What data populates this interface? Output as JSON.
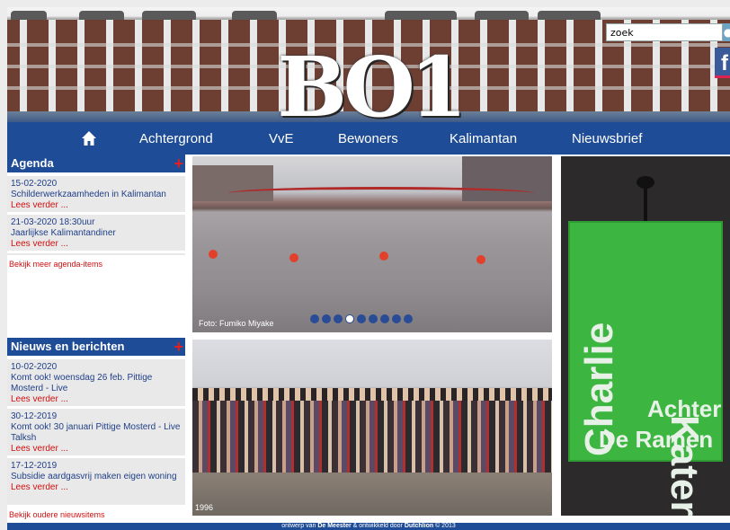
{
  "header": {
    "logo_text": "BO1",
    "search": {
      "value": "zoek",
      "placeholder": "zoek"
    },
    "facebook_icon": "f"
  },
  "nav": {
    "home_icon": "home-icon",
    "items": [
      {
        "label": "Achtergrond"
      },
      {
        "label": "VvE"
      },
      {
        "label": "Bewoners"
      },
      {
        "label": "Kalimantan"
      },
      {
        "label": "Nieuwsbrief"
      }
    ]
  },
  "agenda": {
    "title": "Agenda",
    "items": [
      {
        "date": "15-02-2020",
        "title": "Schilderwerkzaamheden in Kalimantan",
        "more": "Lees verder ..."
      },
      {
        "date": "21-03-2020  18:30uur",
        "title": "Jaarlijkse Kalimantandiner",
        "more": "Lees verder ..."
      }
    ],
    "more_link": "Bekijk meer agenda-items"
  },
  "news": {
    "title": "Nieuws en berichten",
    "items": [
      {
        "date": "10-02-2020",
        "title": "Komt ook! woensdag 26 feb. Pittige Mosterd - Live",
        "more": "Lees verder ..."
      },
      {
        "date": "30-12-2019",
        "title": "Komt ook! 30 januari Pittige Mosterd - Live Talksh",
        "more": "Lees verder ..."
      },
      {
        "date": "17-12-2019",
        "title": "Subsidie aardgasvrij maken eigen woning",
        "more": "Lees verder ..."
      }
    ],
    "more_link": "Bekijk oudere nieuwsitems"
  },
  "slideshow": {
    "caption": "Foto: Fumiko Miyake",
    "dot_count": 9,
    "active_dot": 3
  },
  "group_photo": {
    "caption": "1996"
  },
  "poster": {
    "left_text": "Charlie",
    "right_text": "Kater",
    "line1": "Achter",
    "line2": "De Ramen"
  },
  "footer": {
    "prefix": "ontwerp van ",
    "designer": "De Meester",
    "middle": " & ontwikkeld door ",
    "developer": "Dutchlion",
    "suffix": " © 2013"
  },
  "colors": {
    "brand_blue": "#1f4c96",
    "accent_red": "#d01010",
    "poster_green": "#3cb640"
  }
}
